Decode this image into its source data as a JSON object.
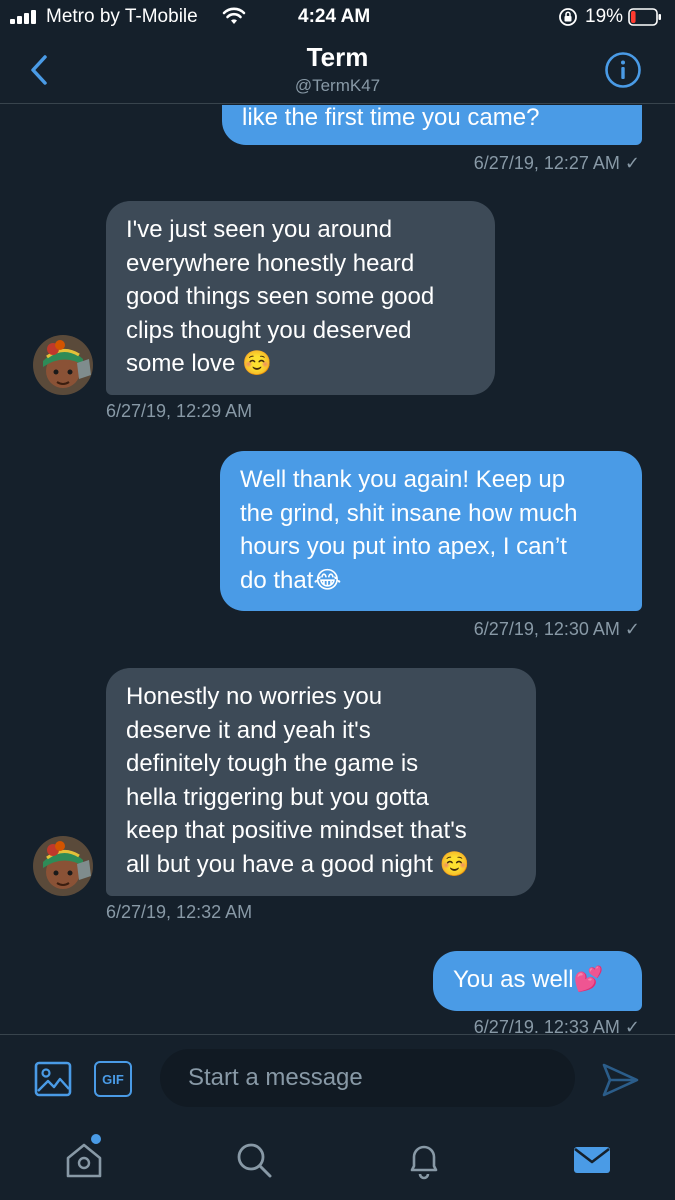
{
  "status_bar": {
    "carrier": "Metro by T-Mobile",
    "time": "4:24 AM",
    "battery_percent": "19%",
    "battery_level": 0.19,
    "icons": [
      "signal-icon",
      "wifi-icon",
      "orientation-lock-icon",
      "battery-icon"
    ]
  },
  "header": {
    "title": "Term",
    "handle": "@TermK47",
    "back_icon": "chevron-left-icon",
    "info_icon": "info-icon"
  },
  "messages": [
    {
      "direction": "sent",
      "text": "like the first time you came?",
      "timestamp": "6/27/19, 12:27 AM ✓"
    },
    {
      "direction": "received",
      "lines": [
        "I've just seen you around",
        "everywhere honestly heard",
        "good things seen some good",
        "clips thought you deserved",
        "some love ☺️"
      ],
      "timestamp": "6/27/19, 12:29 AM"
    },
    {
      "direction": "sent",
      "lines": [
        "Well thank you again! Keep up",
        "the grind, shit insane how much",
        "hours you put into apex, I can’t",
        "do that😂"
      ],
      "timestamp": "6/27/19, 12:30 AM ✓"
    },
    {
      "direction": "received",
      "lines": [
        "Honestly no worries you",
        "deserve it and yeah it's",
        "definitely tough the game is",
        "hella triggering but you gotta",
        "keep that positive mindset that's",
        "all but you have a good night ☺️"
      ],
      "timestamp": "6/27/19, 12:32 AM"
    },
    {
      "direction": "sent",
      "text": "You as well💕",
      "timestamp": "6/27/19, 12:33 AM ✓"
    }
  ],
  "composer": {
    "placeholder": "Start a message",
    "gif_label": "GIF",
    "media_icon": "image-icon",
    "send_icon": "send-icon"
  },
  "tabbar": {
    "items": [
      "home-icon",
      "search-icon",
      "notifications-icon",
      "messages-icon"
    ],
    "active": "messages-icon",
    "accent": "#4a9be6",
    "inactive_color": "#8899a6"
  },
  "colors": {
    "background": "#15202b",
    "sent_bubble": "#4a9be6",
    "received_bubble": "#3d4a57",
    "secondary_text": "#8899a6"
  }
}
